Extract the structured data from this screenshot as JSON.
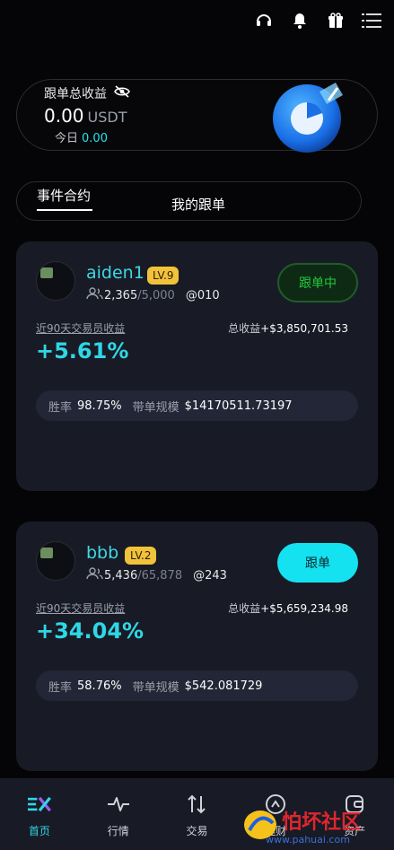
{
  "topbar": {
    "icons": [
      "headset-icon",
      "bell-icon",
      "gift-icon",
      "menu-icon"
    ]
  },
  "summary": {
    "label": "跟单总收益",
    "amount": "0.00",
    "unit": "USDT",
    "today_label": "今日",
    "today_value": "0.00"
  },
  "tabs": {
    "tab1": "事件合约",
    "tab2": "我的跟单"
  },
  "cards": [
    {
      "name": "aiden1",
      "level": "LV.9",
      "followers": "2,365",
      "max_followers": "/5,000",
      "handle": "@010",
      "button": "跟单中",
      "sublabel": "近90天交易员收益",
      "total_label": "总收益",
      "total_value": "+$3,850,701.53",
      "pct": "+5.61%",
      "win_label": "胜率",
      "win_value": "98.75%",
      "scale_label": "带单规模",
      "scale_value": "$14170511.73197"
    },
    {
      "name": "bbb",
      "level": "LV.2",
      "followers": "5,436",
      "max_followers": "/65,878",
      "handle": "@243",
      "button": "跟单",
      "sublabel": "近90天交易员收益",
      "total_label": "总收益",
      "total_value": "+$5,659,234.98",
      "pct": "+34.04%",
      "win_label": "胜率",
      "win_value": "58.76%",
      "scale_label": "带单规模",
      "scale_value": "$542.081729"
    }
  ],
  "nav": [
    {
      "label": "首页",
      "icon": "logo-home-icon"
    },
    {
      "label": "行情",
      "icon": "pulse-icon"
    },
    {
      "label": "交易",
      "icon": "swap-icon"
    },
    {
      "label": "理财",
      "icon": "finance-icon"
    },
    {
      "label": "资产",
      "icon": "wallet-icon"
    }
  ],
  "watermark": {
    "text": "怕坏社区",
    "url": "www.pahuai.com"
  },
  "colors": {
    "accent": "#2fd7e6",
    "follow_green": "#21c93e",
    "level_gold": "#f2c23b",
    "card_bg": "#181b26"
  }
}
